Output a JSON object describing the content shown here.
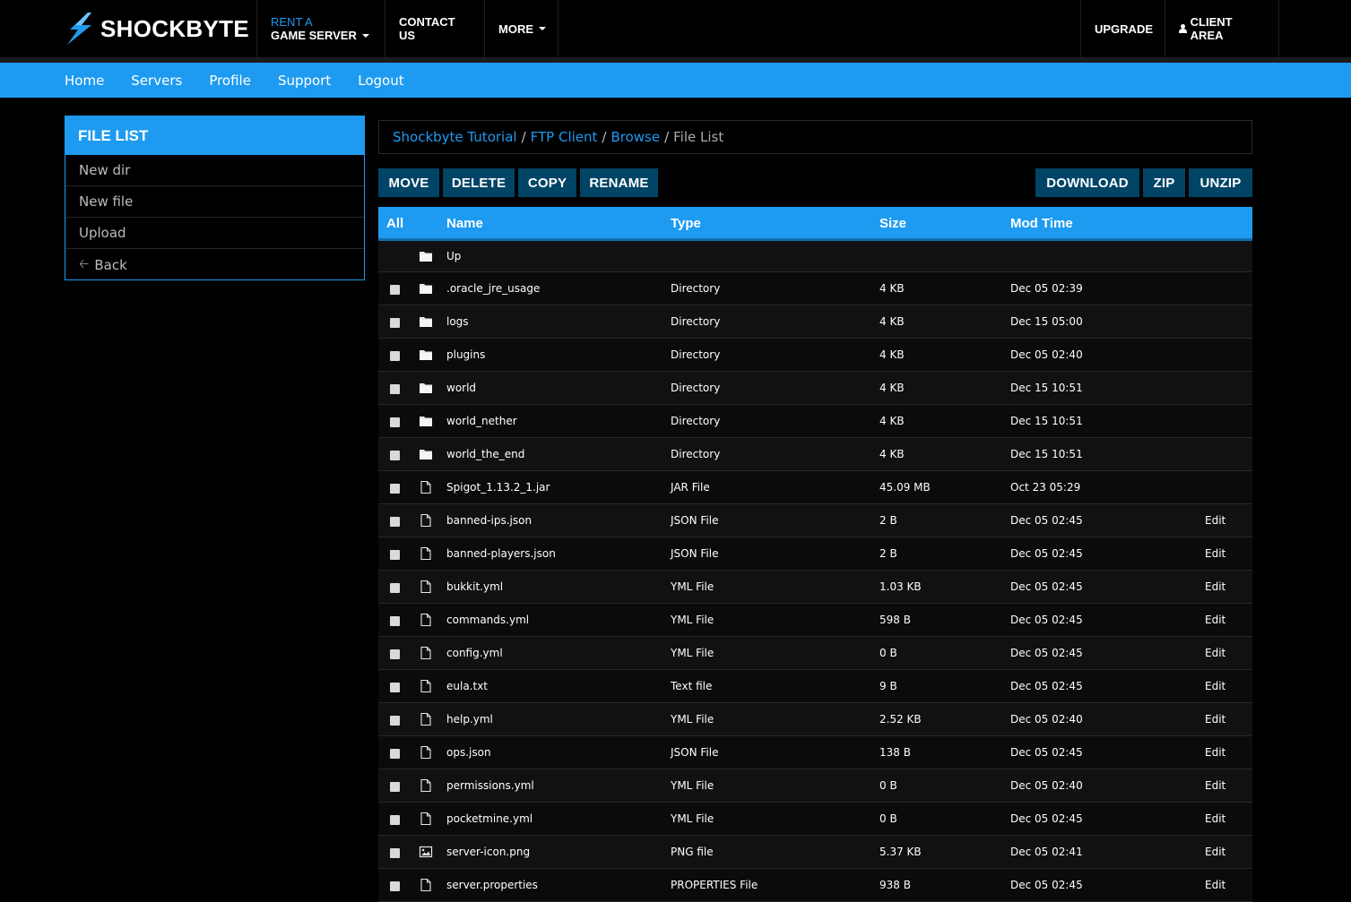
{
  "brand": {
    "name": "SHOCKBYTE"
  },
  "topnav": {
    "rent_a": "RENT A",
    "game_server": "GAME SERVER",
    "contact": "CONTACT US",
    "more": "MORE",
    "upgrade": "UPGRADE",
    "client_area": "CLIENT AREA"
  },
  "subnav": [
    "Home",
    "Servers",
    "Profile",
    "Support",
    "Logout"
  ],
  "sidebar": {
    "title": "FILE LIST",
    "items": [
      "New dir",
      "New file",
      "Upload",
      "Back"
    ]
  },
  "breadcrumb": [
    "Shockbyte Tutorial",
    "FTP Client",
    "Browse",
    "File List"
  ],
  "actions": {
    "move": "MOVE",
    "delete": "DELETE",
    "copy": "COPY",
    "rename": "RENAME",
    "download": "DOWNLOAD",
    "zip": "ZIP",
    "unzip": "UNZIP"
  },
  "table": {
    "headers": {
      "all": "All",
      "name": "Name",
      "type": "Type",
      "size": "Size",
      "mod_time": "Mod Time"
    },
    "up_label": "Up",
    "rows": [
      {
        "name": ".oracle_jre_usage",
        "type": "Directory",
        "size": "4 KB",
        "time": "Dec 05 02:39",
        "edit": "",
        "icon": "folder-icon"
      },
      {
        "name": "logs",
        "type": "Directory",
        "size": "4 KB",
        "time": "Dec 15 05:00",
        "edit": "",
        "icon": "folder-icon"
      },
      {
        "name": "plugins",
        "type": "Directory",
        "size": "4 KB",
        "time": "Dec 05 02:40",
        "edit": "",
        "icon": "folder-icon"
      },
      {
        "name": "world",
        "type": "Directory",
        "size": "4 KB",
        "time": "Dec 15 10:51",
        "edit": "",
        "icon": "folder-icon"
      },
      {
        "name": "world_nether",
        "type": "Directory",
        "size": "4 KB",
        "time": "Dec 15 10:51",
        "edit": "",
        "icon": "folder-icon"
      },
      {
        "name": "world_the_end",
        "type": "Directory",
        "size": "4 KB",
        "time": "Dec 15 10:51",
        "edit": "",
        "icon": "folder-icon"
      },
      {
        "name": "Spigot_1.13.2_1.jar",
        "type": "JAR File",
        "size": "45.09 MB",
        "time": "Oct 23 05:29",
        "edit": "",
        "icon": "file-icon"
      },
      {
        "name": "banned-ips.json",
        "type": "JSON File",
        "size": "2 B",
        "time": "Dec 05 02:45",
        "edit": "Edit",
        "icon": "file-icon"
      },
      {
        "name": "banned-players.json",
        "type": "JSON File",
        "size": "2 B",
        "time": "Dec 05 02:45",
        "edit": "Edit",
        "icon": "file-icon"
      },
      {
        "name": "bukkit.yml",
        "type": "YML File",
        "size": "1.03 KB",
        "time": "Dec 05 02:45",
        "edit": "Edit",
        "icon": "file-icon"
      },
      {
        "name": "commands.yml",
        "type": "YML File",
        "size": "598 B",
        "time": "Dec 05 02:45",
        "edit": "Edit",
        "icon": "file-icon"
      },
      {
        "name": "config.yml",
        "type": "YML File",
        "size": "0 B",
        "time": "Dec 05 02:45",
        "edit": "Edit",
        "icon": "file-icon"
      },
      {
        "name": "eula.txt",
        "type": "Text file",
        "size": "9 B",
        "time": "Dec 05 02:45",
        "edit": "Edit",
        "icon": "file-icon"
      },
      {
        "name": "help.yml",
        "type": "YML File",
        "size": "2.52 KB",
        "time": "Dec 05 02:40",
        "edit": "Edit",
        "icon": "file-icon"
      },
      {
        "name": "ops.json",
        "type": "JSON File",
        "size": "138 B",
        "time": "Dec 05 02:45",
        "edit": "Edit",
        "icon": "file-icon"
      },
      {
        "name": "permissions.yml",
        "type": "YML File",
        "size": "0 B",
        "time": "Dec 05 02:40",
        "edit": "Edit",
        "icon": "file-icon"
      },
      {
        "name": "pocketmine.yml",
        "type": "YML File",
        "size": "0 B",
        "time": "Dec 05 02:45",
        "edit": "Edit",
        "icon": "file-icon"
      },
      {
        "name": "server-icon.png",
        "type": "PNG file",
        "size": "5.37 KB",
        "time": "Dec 05 02:41",
        "edit": "Edit",
        "icon": "image-icon"
      },
      {
        "name": "server.properties",
        "type": "PROPERTIES File",
        "size": "938 B",
        "time": "Dec 05 02:45",
        "edit": "Edit",
        "icon": "file-icon"
      }
    ]
  },
  "colors": {
    "accent": "#1e9bf0",
    "button": "#004466",
    "background": "#000000"
  }
}
